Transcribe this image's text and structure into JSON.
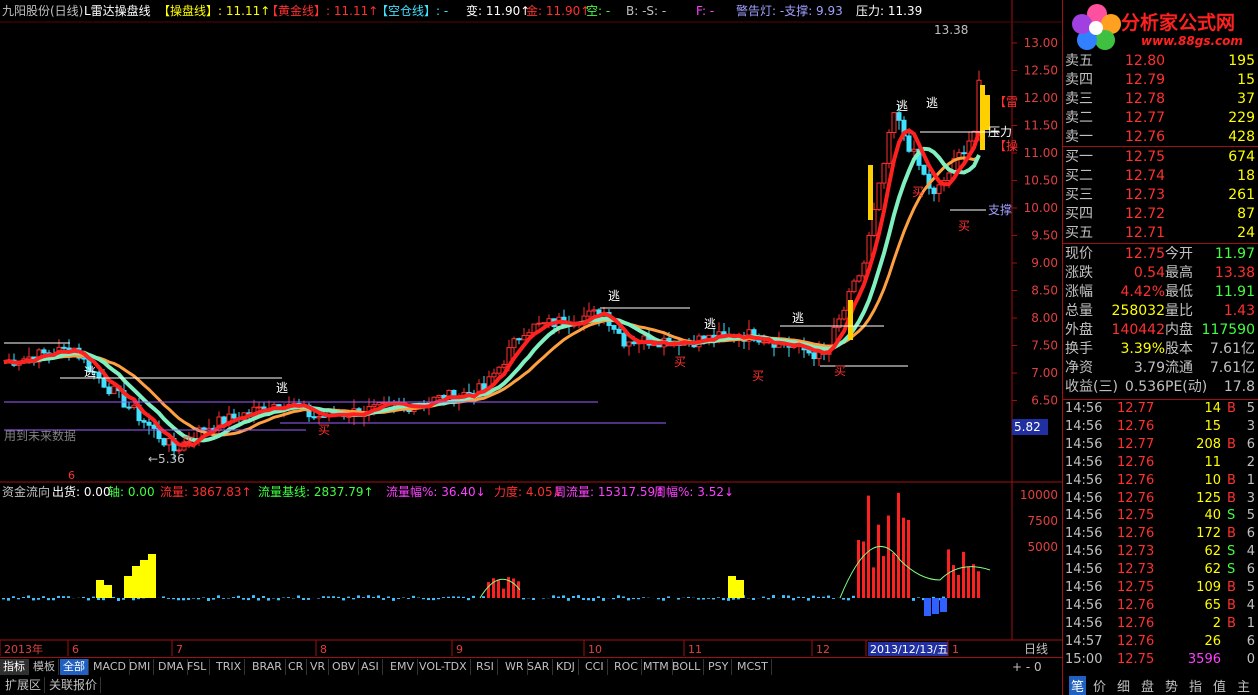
{
  "header": {
    "title": "九阳股份(日线)",
    "indicator": "L雷达操盘线",
    "items": [
      {
        "label": "【操盘线】",
        "value": ": 11.11↑",
        "color": "#ffff00"
      },
      {
        "label": "【黄金线】",
        "value": ": 11.11↑",
        "color": "#ff3030"
      },
      {
        "label": "【空仓线】",
        "value": ": -",
        "color": "#40e0ff"
      },
      {
        "label": "变:",
        "value": " 11.90↑",
        "color": "#ffffff"
      },
      {
        "label": "金:",
        "value": " 11.90↑",
        "color": "#ff3030"
      },
      {
        "label": "空:",
        "value": " -",
        "color": "#40ff40"
      },
      {
        "label": "B: -",
        "value": "S: -",
        "color": "#c0c0c0"
      },
      {
        "label": "F: -",
        "value": "",
        "color": "#ff40ff"
      },
      {
        "label": "警告灯: -",
        "value": "支撑: 9.93",
        "color": "#a0a0ff"
      },
      {
        "label": "压力:",
        "value": " 11.39",
        "color": "#ffffff"
      }
    ]
  },
  "price_axis": [
    "13.00",
    "12.50",
    "12.00",
    "11.50",
    "11.00",
    "10.50",
    "10.00",
    "9.50",
    "9.00",
    "8.50",
    "8.00",
    "7.50",
    "7.00",
    "6.50"
  ],
  "price_axis_extra": "5.82",
  "vol_axis": [
    "10000",
    "7500",
    "5000"
  ],
  "annotations": {
    "high": "13.38",
    "low": "←5.36",
    "future_note": "用到未来数据",
    "escape": "逃",
    "buy": "买",
    "pressure": "压力",
    "support": "支撑",
    "tag1": "【雷",
    "tag2": "【操"
  },
  "sub_header": {
    "name": "资金流向",
    "items": [
      {
        "label": "出货:",
        "value": " 0.00",
        "color": "#ffffff"
      },
      {
        "label": "轴:",
        "value": " 0.00",
        "color": "#40ff40"
      },
      {
        "label": "流量:",
        "value": " 3867.83↑",
        "color": "#ff3030"
      },
      {
        "label": "流量基线:",
        "value": " 2837.79↑",
        "color": "#40ff40"
      },
      {
        "label": "流量幅%:",
        "value": " 36.40↓",
        "color": "#ff40ff"
      },
      {
        "label": "力度:",
        "value": " 4.05↓",
        "color": "#ff3030"
      },
      {
        "label": "周流量:",
        "value": " 15317.59↑",
        "color": "#ff40ff"
      },
      {
        "label": "周幅%:",
        "value": " 3.52↓",
        "color": "#ff40ff"
      }
    ]
  },
  "time_axis": [
    "2013年",
    "6",
    "7",
    "8",
    "9",
    "10",
    "11",
    "12",
    "2013/12/13/五",
    "1"
  ],
  "period": "日线",
  "tabs": [
    "指标",
    "模板",
    "全部",
    "MACD",
    "DMI",
    "DMA",
    "FSL",
    "TRIX",
    "BRAR",
    "CR",
    "VR",
    "OBV",
    "ASI",
    "EMV",
    "VOL-TDX",
    "RSI",
    "WR",
    "SAR",
    "KDJ",
    "CCI",
    "ROC",
    "MTM",
    "BOLL",
    "PSY",
    "MCST"
  ],
  "tabs2": [
    "扩展区",
    "关联报价"
  ],
  "logo": {
    "brand": "分析家公式网",
    "url": "www.88gs.com"
  },
  "order_book": {
    "sell": [
      {
        "label": "卖五",
        "price": "12.80",
        "vol": "195"
      },
      {
        "label": "卖四",
        "price": "12.79",
        "vol": "15"
      },
      {
        "label": "卖三",
        "price": "12.78",
        "vol": "37"
      },
      {
        "label": "卖二",
        "price": "12.77",
        "vol": "229"
      },
      {
        "label": "卖一",
        "price": "12.76",
        "vol": "428"
      }
    ],
    "buy": [
      {
        "label": "买一",
        "price": "12.75",
        "vol": "674"
      },
      {
        "label": "买二",
        "price": "12.74",
        "vol": "18"
      },
      {
        "label": "买三",
        "price": "12.73",
        "vol": "261"
      },
      {
        "label": "买四",
        "price": "12.72",
        "vol": "87"
      },
      {
        "label": "买五",
        "price": "12.71",
        "vol": "24"
      }
    ]
  },
  "quote": [
    {
      "l1": "现价",
      "v1": "12.75",
      "l2": "今开",
      "v2": "11.97",
      "c1": "#ff3030",
      "c2": "#40ff40"
    },
    {
      "l1": "涨跌",
      "v1": "0.54",
      "l2": "最高",
      "v2": "13.38",
      "c1": "#ff3030",
      "c2": "#ff3030"
    },
    {
      "l1": "涨幅",
      "v1": "4.42%",
      "l2": "最低",
      "v2": "11.91",
      "c1": "#ff3030",
      "c2": "#40ff40"
    },
    {
      "l1": "总量",
      "v1": "258032",
      "l2": "量比",
      "v2": "1.43",
      "c1": "#ffff00",
      "c2": "#ff3030"
    },
    {
      "l1": "外盘",
      "v1": "140442",
      "l2": "内盘",
      "v2": "117590",
      "c1": "#ff3030",
      "c2": "#40ff40"
    },
    {
      "l1": "换手",
      "v1": "3.39%",
      "l2": "股本",
      "v2": "7.61亿",
      "c1": "#ffff00",
      "c2": "#c0c0c0"
    },
    {
      "l1": "净资",
      "v1": "3.79",
      "l2": "流通",
      "v2": "7.61亿",
      "c1": "#c0c0c0",
      "c2": "#c0c0c0"
    },
    {
      "l1": "收益(三)",
      "v1": "0.536",
      "l2": "PE(动)",
      "v2": "17.8",
      "c1": "#c0c0c0",
      "c2": "#c0c0c0"
    }
  ],
  "ticks": [
    {
      "t": "14:56",
      "p": "12.77",
      "v": "14",
      "d": "B",
      "n": "5"
    },
    {
      "t": "14:56",
      "p": "12.76",
      "v": "15",
      "d": "",
      "n": "3"
    },
    {
      "t": "14:56",
      "p": "12.77",
      "v": "208",
      "d": "B",
      "n": "6"
    },
    {
      "t": "14:56",
      "p": "12.76",
      "v": "11",
      "d": "",
      "n": "2"
    },
    {
      "t": "14:56",
      "p": "12.76",
      "v": "10",
      "d": "B",
      "n": "1"
    },
    {
      "t": "14:56",
      "p": "12.76",
      "v": "125",
      "d": "B",
      "n": "3"
    },
    {
      "t": "14:56",
      "p": "12.75",
      "v": "40",
      "d": "S",
      "n": "5"
    },
    {
      "t": "14:56",
      "p": "12.76",
      "v": "172",
      "d": "B",
      "n": "6"
    },
    {
      "t": "14:56",
      "p": "12.73",
      "v": "62",
      "d": "S",
      "n": "4"
    },
    {
      "t": "14:56",
      "p": "12.73",
      "v": "62",
      "d": "S",
      "n": "6"
    },
    {
      "t": "14:56",
      "p": "12.75",
      "v": "109",
      "d": "B",
      "n": "5"
    },
    {
      "t": "14:56",
      "p": "12.76",
      "v": "65",
      "d": "B",
      "n": "4"
    },
    {
      "t": "14:56",
      "p": "12.76",
      "v": "2",
      "d": "B",
      "n": "1"
    },
    {
      "t": "14:57",
      "p": "12.76",
      "v": "26",
      "d": "",
      "n": "6"
    },
    {
      "t": "15:00",
      "p": "12.75",
      "v": "3596",
      "d": "",
      "n": "0"
    }
  ],
  "bottom_tabs": [
    "笔",
    "价",
    "细",
    "盘",
    "势",
    "指",
    "值",
    "主"
  ]
}
